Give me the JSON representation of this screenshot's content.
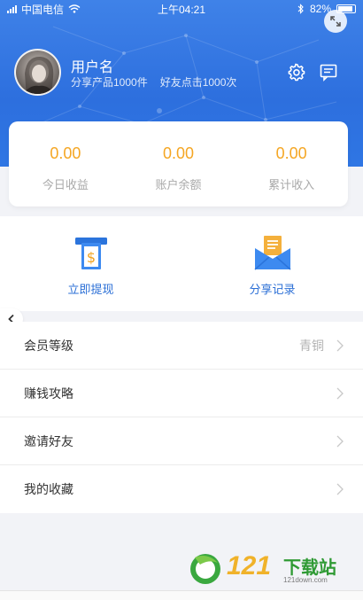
{
  "status_bar": {
    "carrier": "中国电信",
    "time": "上午04:21",
    "battery": "82%"
  },
  "profile": {
    "username": "用户名",
    "shared_products": "分享产品1000件",
    "friend_clicks": "好友点击1000次"
  },
  "balance": [
    {
      "value": "0.00",
      "label": "今日收益"
    },
    {
      "value": "0.00",
      "label": "账户余额"
    },
    {
      "value": "0.00",
      "label": "累计收入"
    }
  ],
  "actions": [
    {
      "label": "立即提现",
      "icon": "withdraw-icon"
    },
    {
      "label": "分享记录",
      "icon": "share-record-icon"
    }
  ],
  "menu": [
    {
      "label": "会员等级",
      "value": "青铜"
    },
    {
      "label": "赚钱攻略",
      "value": ""
    },
    {
      "label": "邀请好友",
      "value": ""
    },
    {
      "label": "我的收藏",
      "value": ""
    }
  ],
  "watermark": {
    "number": "121",
    "text": "下载站",
    "url": "121down.com"
  },
  "colors": {
    "header_blue": "#3f82e8",
    "accent_orange": "#f5a623",
    "action_blue": "#2b6fd6"
  }
}
